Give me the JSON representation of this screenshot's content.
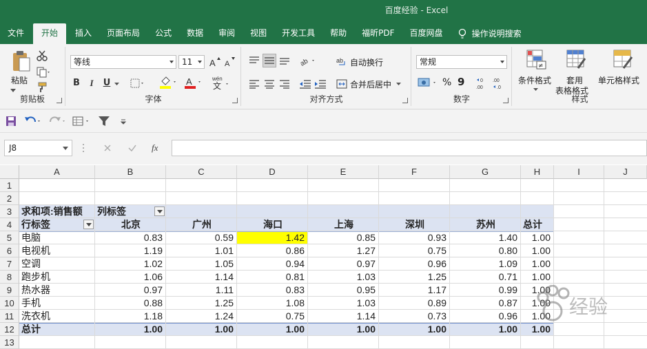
{
  "window": {
    "title": "百度经验  -  Excel"
  },
  "tabs": [
    "文件",
    "开始",
    "插入",
    "页面布局",
    "公式",
    "数据",
    "审阅",
    "视图",
    "开发工具",
    "帮助",
    "福昕PDF",
    "百度网盘"
  ],
  "active_tab": "开始",
  "tell_me": "操作说明搜索",
  "ribbon": {
    "clipboard": {
      "label": "剪贴板",
      "paste": "粘贴"
    },
    "font": {
      "label": "字体",
      "name": "等线",
      "size": "11",
      "wen": "wén"
    },
    "alignment": {
      "label": "对齐方式",
      "wrap": "自动换行",
      "merge": "合并后居中"
    },
    "number": {
      "label": "数字",
      "format": "常规",
      "percent": "%",
      "comma": "9"
    },
    "styles": {
      "label": "样式",
      "cond": "条件格式",
      "table_line1": "套用",
      "table_line2": "表格格式",
      "cell": "单元格样式"
    }
  },
  "formula_bar": {
    "name_box": "J8",
    "fx": "fx",
    "formula": ""
  },
  "columns": [
    "A",
    "B",
    "C",
    "D",
    "E",
    "F",
    "G",
    "H",
    "I",
    "J"
  ],
  "rows": [
    "1",
    "2",
    "3",
    "4",
    "5",
    "6",
    "7",
    "8",
    "9",
    "10",
    "11",
    "12",
    "13"
  ],
  "pivot": {
    "value_title": "求和项:销售额",
    "col_label": "列标签",
    "row_label": "行标签",
    "headers": [
      "北京",
      "广州",
      "海口",
      "上海",
      "深圳",
      "苏州",
      "总计"
    ],
    "rows": [
      {
        "name": "电脑",
        "values": [
          "0.83",
          "0.59",
          "1.42",
          "0.85",
          "0.93",
          "1.40",
          "1.00"
        ]
      },
      {
        "name": "电视机",
        "values": [
          "1.19",
          "1.01",
          "0.86",
          "1.27",
          "0.75",
          "0.80",
          "1.00"
        ]
      },
      {
        "name": "空调",
        "values": [
          "1.02",
          "1.05",
          "0.94",
          "0.97",
          "0.96",
          "1.09",
          "1.00"
        ]
      },
      {
        "name": "跑步机",
        "values": [
          "1.06",
          "1.14",
          "0.81",
          "1.03",
          "1.25",
          "0.71",
          "1.00"
        ]
      },
      {
        "name": "热水器",
        "values": [
          "0.97",
          "1.11",
          "0.83",
          "0.95",
          "1.17",
          "0.99",
          "1.00"
        ]
      },
      {
        "name": "手机",
        "values": [
          "0.88",
          "1.25",
          "1.08",
          "1.03",
          "0.89",
          "0.87",
          "1.00"
        ]
      },
      {
        "name": "洗衣机",
        "values": [
          "1.18",
          "1.24",
          "0.75",
          "1.14",
          "0.73",
          "0.96",
          "1.00"
        ]
      }
    ],
    "total": {
      "name": "总计",
      "values": [
        "1.00",
        "1.00",
        "1.00",
        "1.00",
        "1.00",
        "1.00",
        "1.00"
      ]
    },
    "highlight_color": "#ffff00"
  },
  "watermark": "经验",
  "colors": {
    "excel_green": "#217346",
    "pivot_band": "#dce3f2"
  }
}
